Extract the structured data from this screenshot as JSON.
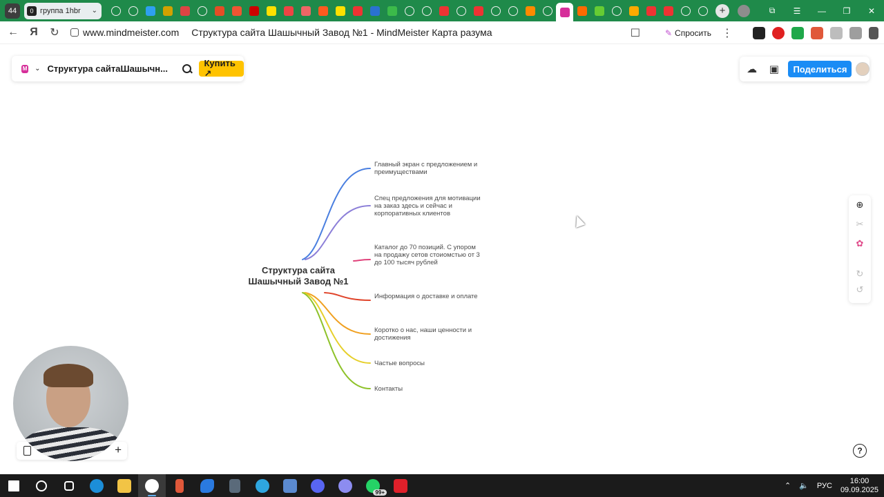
{
  "browser": {
    "tab_count": "44",
    "tab_group": {
      "number": "0",
      "label": "группа 1hbr"
    },
    "tab_icon_colors": [
      "#ffffff",
      "#ffffff",
      "#2ea0f0",
      "#d2a100",
      "#d44",
      "#ffffff",
      "#e44d26",
      "#e53",
      "#c00",
      "#ffe000",
      "#e44",
      "#e66",
      "#ff5a1f",
      "#ffe000",
      "#e33",
      "#2a72d0",
      "#3cba4a",
      "#ffffff",
      "#ffffff",
      "#e33",
      "#ffffff",
      "#e33",
      "#ffffff",
      "#ffffff",
      "#ff8a00",
      "#ffffff",
      "#d62f9a",
      "#ff6a00",
      "#6c3",
      "#ffffff",
      "#fa0",
      "#e33",
      "#e33",
      "#ffffff",
      "#ffffff"
    ],
    "url": "www.mindmeister.com",
    "page_title": "Структура сайта Шашычный Завод №1 - MindMeister Карта разума",
    "ask_label": "Спросить"
  },
  "mindmeister": {
    "map_title": "Структура сайтаШашычн...",
    "buy_label": "Купить ↗",
    "share_label": "Поделиться"
  },
  "mindmap": {
    "central": "Структура сайта Шашычный Завод №1",
    "nodes": [
      {
        "text": "Главный экран с предложением и преимуществами",
        "color": "#4a7fe0"
      },
      {
        "text": "Спец предложения для мотивации на заказ здесь и сейчас и корпоративных клиентов",
        "color": "#8c7fd8"
      },
      {
        "text": "Каталог до 70 позиций. С упором на продажу сетов стоиомстью от 3 до 100 тысяч рублей",
        "color": "#e0417a"
      },
      {
        "text": "Информация о доставке и оплате",
        "color": "#e0442a"
      },
      {
        "text": "Коротко о нас, наши ценности и достижения",
        "color": "#f0a020"
      },
      {
        "text": "Частые вопросы",
        "color": "#e6cf2a"
      },
      {
        "text": "Контакты",
        "color": "#8ec22a"
      }
    ]
  },
  "taskbar": {
    "badge": "99+",
    "language": "РУС",
    "time": "16:00",
    "date": "09.09.2025"
  }
}
